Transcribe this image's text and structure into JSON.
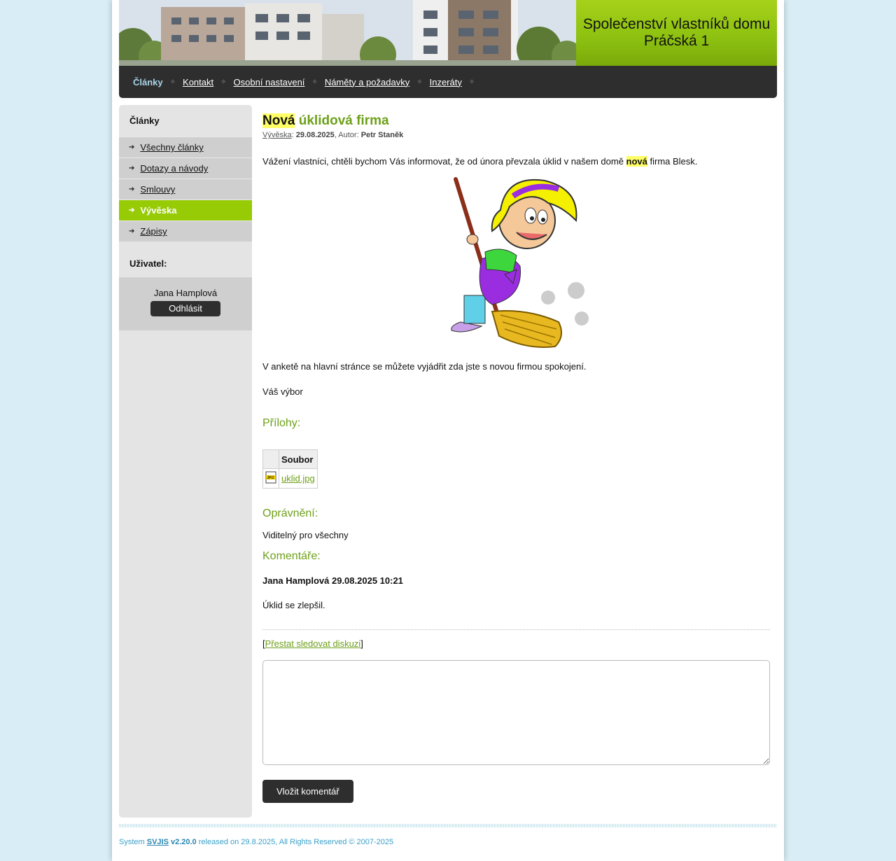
{
  "header": {
    "title_line1": "Společenství vlastníků domu",
    "title_line2": "Práčská 1"
  },
  "nav": {
    "items": [
      "Články",
      "Kontakt",
      "Osobní nastavení",
      "Náměty a požadavky",
      "Inzeráty"
    ],
    "active": "Články"
  },
  "sidebar": {
    "heading": "Články",
    "items": [
      "Všechny články",
      "Dotazy a návody",
      "Smlouvy",
      "Vývěska",
      "Zápisy"
    ],
    "active": "Vývěska",
    "user_heading": "Uživatel:",
    "user_name": "Jana Hamplová",
    "logout_label": "Odhlásit"
  },
  "article": {
    "title_highlight": "Nová",
    "title_rest": " úklidová firma",
    "category": "Vývěska",
    "date": "29.08.2025",
    "author_label": ", Autor: ",
    "author": "Petr Staněk",
    "para1_before": "Vážení vlastníci, chtěli bychom Vás informovat, že od února převzala úklid v našem domě ",
    "para1_highlight": "nová",
    "para1_after": " firma Blesk.",
    "para2": "V anketě na hlavní stránce se můžete vyjádřit zda jste s novou firmou spokojení.",
    "para3": "Váš výbor"
  },
  "attachments": {
    "heading": "Přílohy:",
    "column": "Soubor",
    "files": [
      "uklid.jpg"
    ]
  },
  "permissions": {
    "heading": "Oprávnění:",
    "value": "Viditelný pro všechny"
  },
  "comments": {
    "heading": "Komentáře:",
    "author_line": "Jana Hamplová 29.08.2025 10:21",
    "text": "Úklid se zlepšil.",
    "unfollow": "Přestat sledovat diskuzi",
    "submit": "Vložit komentář"
  },
  "footer": {
    "prefix": "System ",
    "name": "SVJIS",
    "version": " v2.20.0",
    "suffix": " released on 29.8.2025, All Rights Reserved © 2007-2025"
  },
  "colors": {
    "accent_green": "#97cb06",
    "title_green": "#6ea01a",
    "dark": "#2e2e2e",
    "background": "#d8edf5"
  }
}
